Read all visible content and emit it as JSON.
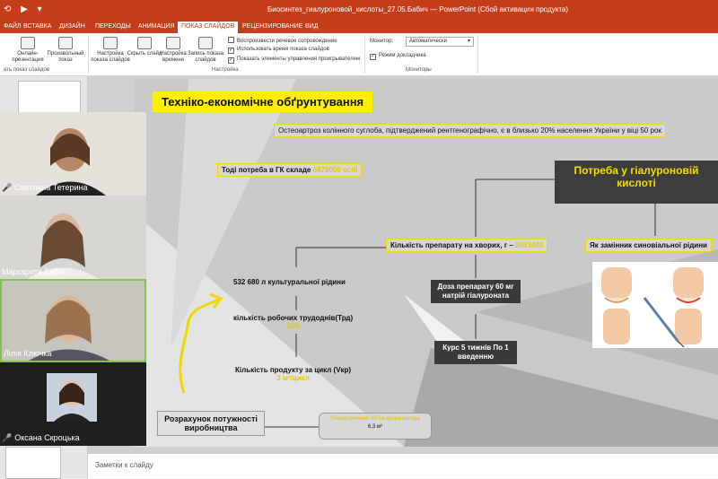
{
  "window": {
    "title": "Биосинтез_гиалуроновой_кислоты_27.05.Бабич — PowerPoint (Сбой активации продукта)"
  },
  "tabs": [
    {
      "label": "ФАЙЛ"
    },
    {
      "label": "ВСТАВКА"
    },
    {
      "label": "ДИЗАЙН"
    },
    {
      "label": "ПЕРЕХОДЫ"
    },
    {
      "label": "АНИМАЦИЯ"
    },
    {
      "label": "ПОКАЗ СЛАЙДОВ"
    },
    {
      "label": "РЕЦЕНЗИРОВАНИЕ"
    },
    {
      "label": "ВИД"
    }
  ],
  "ribbon": {
    "buttons": [
      {
        "label": "Онлайн-презентация"
      },
      {
        "label": "Произвольный показ"
      },
      {
        "label": "Настройка показа слайдов"
      },
      {
        "label": "Скрыть слайд"
      },
      {
        "label": "Настройка времени"
      },
      {
        "label": "Запись показа слайдов"
      }
    ],
    "checkboxes": [
      {
        "label": "Воспроизвести речевое сопровождение",
        "checked": false
      },
      {
        "label": "Использовать время показа слайдов",
        "checked": true
      },
      {
        "label": "Показать элементы управления проигрывателем",
        "checked": true
      },
      {
        "label": "Режим докладчика",
        "checked": true
      }
    ],
    "monitor_label": "Монитор:",
    "monitor_value": "Автоматически",
    "groups": {
      "start": "ать показ слайдов",
      "setup": "Настройка",
      "monitors": "Мониторы"
    }
  },
  "slide": {
    "title": "Техніко-економічне обґрунтування",
    "subtitle": "Остеоартроз колінного суглоба, підтверджений рентгенографічно, є в близько 20% населення України у віці 50 рок",
    "need_text": "Тоді потреба в ГК складе",
    "need_value": "6878000 осіб",
    "need_box": "Потреба у гіалуроновій кислоті",
    "amount_text": "Кількість препарату на хворих, г –",
    "amount_value": "2663400",
    "substitute": "Як замінник синовіальної рідини",
    "culture": "532 680 л культуральної рідини",
    "workdays": "кількість робочих трудоднів(Трд)",
    "workdays_value": "300",
    "product": "Кількість продукту за цикл (Vкр)",
    "product_value": "3 м³/цикл",
    "dose": "Доза препарату 60 мг натрій гіалуроната",
    "course": "Курс 5 тижнів По 1 введенню",
    "capacity": "Розрахунок потужності виробництва",
    "fermenter": "Геометричний об'єм ферментера",
    "fermenter_value": "6,3 м³"
  },
  "notes_placeholder": "Заметки к слайду",
  "participants": [
    {
      "name": "Светлана Тетерина"
    },
    {
      "name": "Маргарита Бабіч"
    },
    {
      "name": "Лілія Ключка"
    },
    {
      "name": "Оксана Скроцька"
    }
  ],
  "colors": {
    "ribbon": "#c43e1c",
    "slide_yellow": "#ffee00",
    "active_speaker": "#7ec64a"
  }
}
